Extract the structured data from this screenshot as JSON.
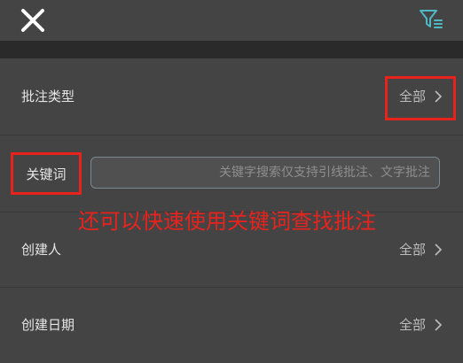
{
  "header": {
    "close_icon": "close-icon",
    "filter_icon": "filter-icon",
    "accent_color": "#4fb8c4"
  },
  "filters": {
    "annotation_type": {
      "label": "批注类型",
      "value": "全部"
    },
    "keyword": {
      "label": "关键词",
      "value": "",
      "placeholder": "关键字搜索仅支持引线批注、文字批注"
    },
    "creator": {
      "label": "创建人",
      "value": "全部"
    },
    "created_date": {
      "label": "创建日期",
      "value": "全部"
    }
  },
  "callout": {
    "text": "还可以快速使用关键词查找批注",
    "color": "#e8231e"
  }
}
